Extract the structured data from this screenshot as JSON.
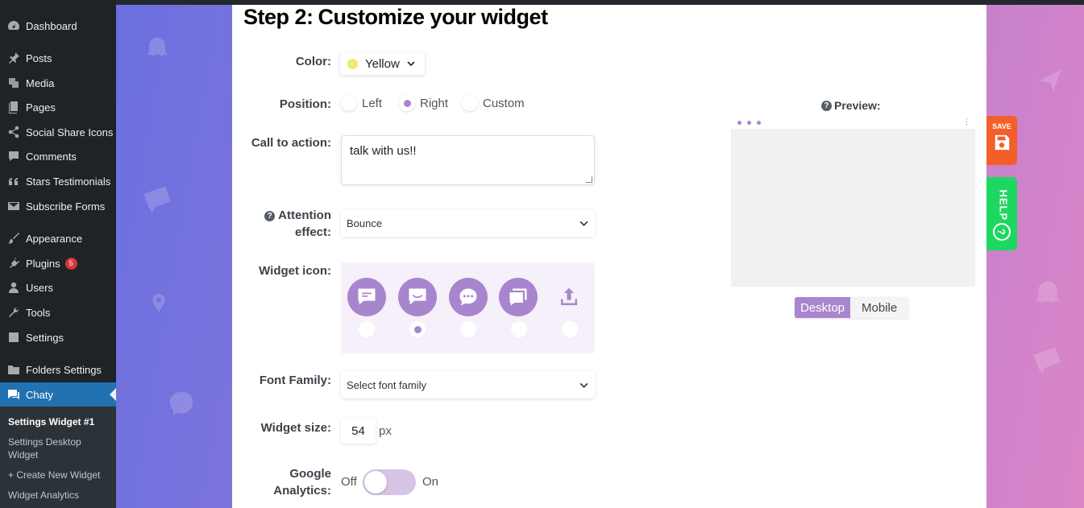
{
  "sidebar": {
    "items": [
      {
        "label": "Dashboard",
        "icon": "dashboard-icon"
      },
      {
        "label": "Posts",
        "icon": "pin-icon"
      },
      {
        "label": "Media",
        "icon": "media-icon"
      },
      {
        "label": "Pages",
        "icon": "pages-icon"
      },
      {
        "label": "Social Share Icons",
        "icon": "share-icon"
      },
      {
        "label": "Comments",
        "icon": "comment-icon"
      },
      {
        "label": "Stars Testimonials",
        "icon": "quote-icon"
      },
      {
        "label": "Subscribe Forms",
        "icon": "envelope-icon"
      },
      {
        "label": "Appearance",
        "icon": "brush-icon"
      },
      {
        "label": "Plugins",
        "icon": "plugin-icon",
        "badge": "5"
      },
      {
        "label": "Users",
        "icon": "user-icon"
      },
      {
        "label": "Tools",
        "icon": "wrench-icon"
      },
      {
        "label": "Settings",
        "icon": "settings-icon"
      },
      {
        "label": "Folders Settings",
        "icon": "folder-icon"
      },
      {
        "label": "Chaty",
        "icon": "chat-icon",
        "active": true
      }
    ],
    "submenu": [
      {
        "label": "Settings Widget #1",
        "current": true
      },
      {
        "label": "Settings Desktop Widget"
      },
      {
        "label": "+ Create New Widget"
      },
      {
        "label": "Widget Analytics"
      }
    ]
  },
  "step": {
    "number": "Step 2:",
    "title": "Customize your widget"
  },
  "form": {
    "color_label": "Color:",
    "color_value": "Yellow",
    "color_swatch": "#eeeb6b",
    "position_label": "Position:",
    "position_options": [
      "Left",
      "Right",
      "Custom"
    ],
    "position_selected": "Right",
    "cta_label": "Call to action:",
    "cta_value": "talk with us!!",
    "attention_label_1": "Attention",
    "attention_label_2": "effect:",
    "attention_value": "Bounce",
    "widget_icon_label": "Widget icon:",
    "widget_icons": [
      "chat-bubble-lines-icon",
      "chat-bubble-smile-icon",
      "chat-dots-icon",
      "chat-stack-icon",
      "upload-icon"
    ],
    "widget_icon_selected": 1,
    "font_label": "Font Family:",
    "font_placeholder": "Select font family",
    "size_label": "Widget size:",
    "size_value": "54",
    "size_unit": "px",
    "ga_label_1": "Google",
    "ga_label_2": "Analytics:",
    "ga_off": "Off",
    "ga_on": "On"
  },
  "preview": {
    "title": "Preview:",
    "tabs": [
      "Desktop",
      "Mobile"
    ],
    "active_tab": "Desktop"
  },
  "floating": {
    "save_label": "SAVE",
    "help_label": "HELP",
    "help_mark": "?"
  },
  "colors": {
    "accent": "#a886cd",
    "save": "#f45e2a",
    "help": "#1ed760",
    "wp_active": "#2271b1"
  }
}
